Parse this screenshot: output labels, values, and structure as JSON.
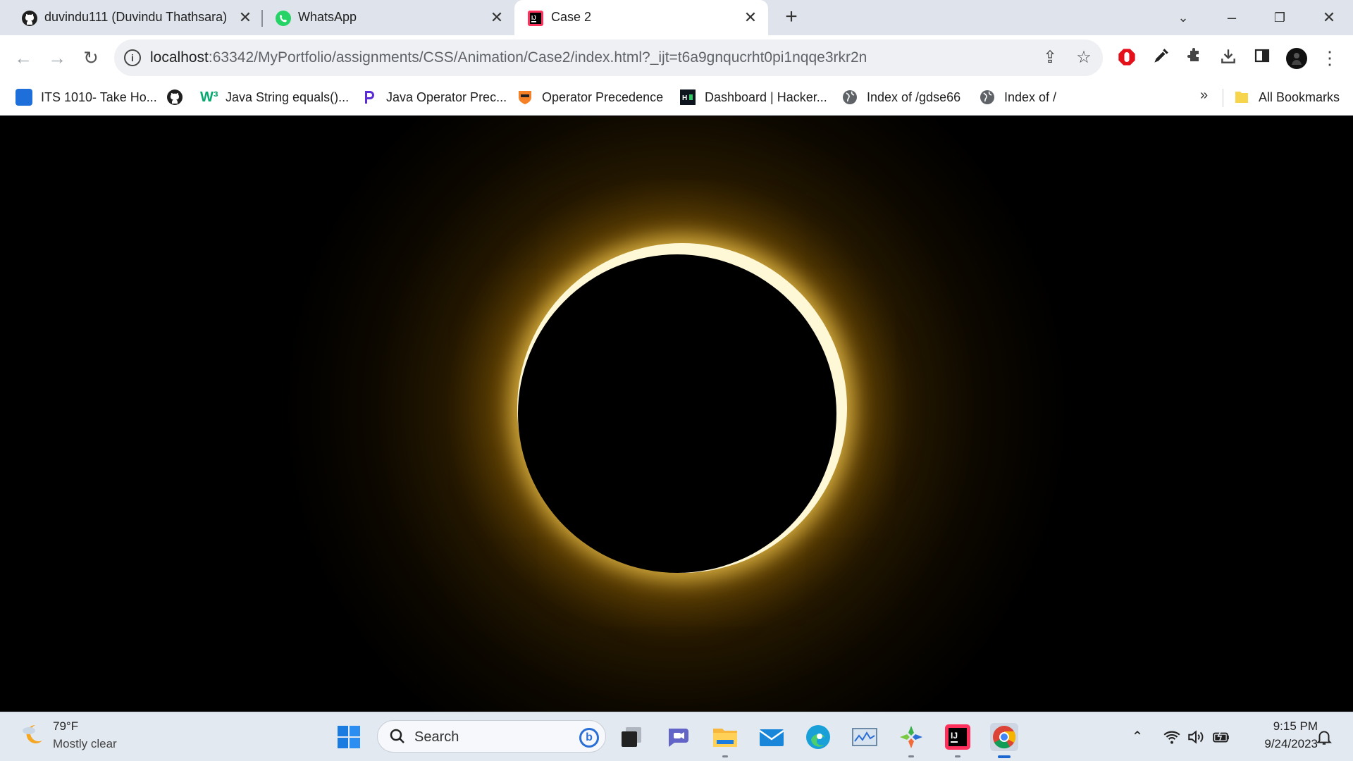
{
  "tabs": [
    {
      "title": "duvindu111 (Duvindu Thathsara)",
      "favicon": "github-icon"
    },
    {
      "title": "WhatsApp",
      "favicon": "whatsapp-icon"
    },
    {
      "title": "Case 2",
      "favicon": "intellij-icon",
      "active": true
    }
  ],
  "toolbar": {
    "url_host": "localhost",
    "url_rest": ":63342/MyPortfolio/assignments/CSS/Animation/Case2/index.html?_ijt=t6a9gnqucrht0pi1nqqe3rkr2n"
  },
  "bookmarks": {
    "items": [
      {
        "label": "ITS 1010- Take Ho...",
        "icon": "classroom-icon"
      },
      {
        "label": "",
        "icon": "github-icon"
      },
      {
        "label": "Java String equals()...",
        "icon": "w3schools-icon"
      },
      {
        "label": "Java Operator Prec...",
        "icon": "programiz-icon"
      },
      {
        "label": "Operator Precedence",
        "icon": "princeton-icon"
      },
      {
        "label": "Dashboard | Hacker...",
        "icon": "hackerrank-icon"
      },
      {
        "label": "Index of /gdse66",
        "icon": "globe-icon"
      },
      {
        "label": "Index of /",
        "icon": "globe-icon"
      }
    ],
    "more": "»",
    "all_bookmarks": "All Bookmarks"
  },
  "taskbar": {
    "weather_temp": "79°F",
    "weather_desc": "Mostly clear",
    "search_label": "Search",
    "clock_time": "9:15 PM",
    "clock_date": "9/24/2023"
  },
  "colors": {
    "accent": "#1a67d2",
    "corona": "#f5c542",
    "ring": "#fff8d6"
  }
}
